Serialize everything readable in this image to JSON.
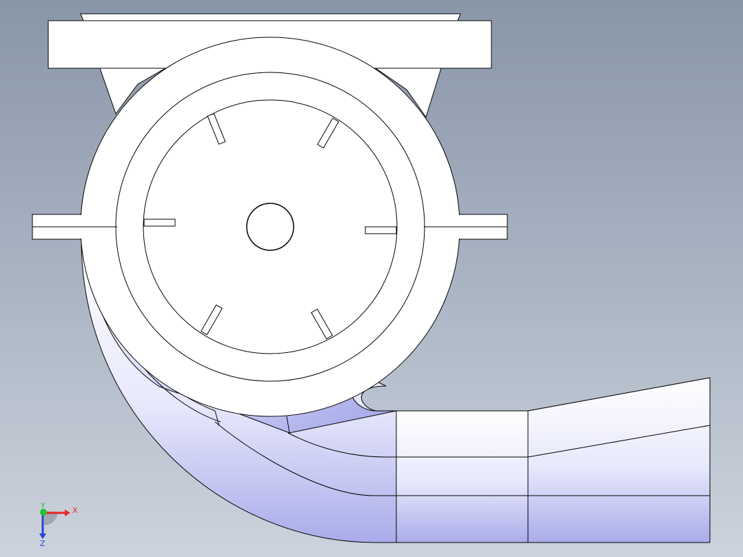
{
  "triad": {
    "x_label": "X",
    "y_label": "Y",
    "z_label": "Z",
    "x_color": "#e8242a",
    "y_color": "#22c332",
    "z_color": "#2a3fd8"
  },
  "colors": {
    "background_top": "#8996a8",
    "background_bottom": "#cdd3dc",
    "part_face": "#ffffff",
    "shaded_face": "#b3b5ea",
    "edge": "#000000"
  }
}
